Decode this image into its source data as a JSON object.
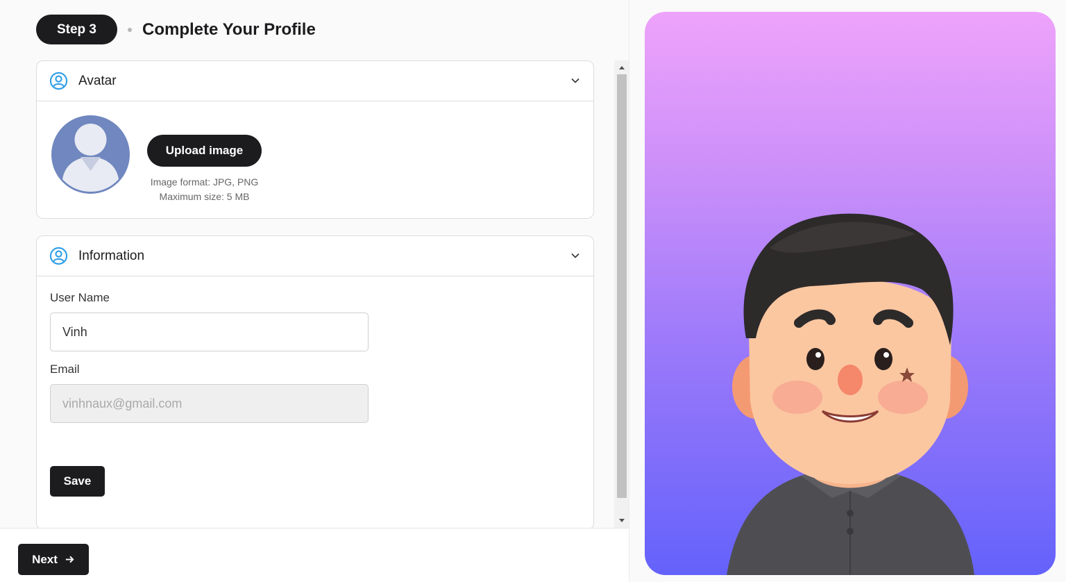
{
  "header": {
    "step_label": "Step 3",
    "title": "Complete Your Profile"
  },
  "avatar_section": {
    "title": "Avatar",
    "upload_label": "Upload image",
    "format_hint": "Image format: JPG, PNG",
    "size_hint": "Maximum size: 5 MB"
  },
  "info_section": {
    "title": "Information",
    "username_label": "User Name",
    "username_value": "Vinh",
    "email_label": "Email",
    "email_value": "vinhnaux@gmail.com",
    "save_label": "Save"
  },
  "footer": {
    "next_label": "Next"
  },
  "colors": {
    "primary": "#1c1c1e",
    "icon_blue": "#2f9ee8",
    "gradient_top": "#eea3fb",
    "gradient_bottom": "#6462fb"
  },
  "icons": [
    "user-circle-icon",
    "chevron-down-icon",
    "arrow-right-icon"
  ]
}
